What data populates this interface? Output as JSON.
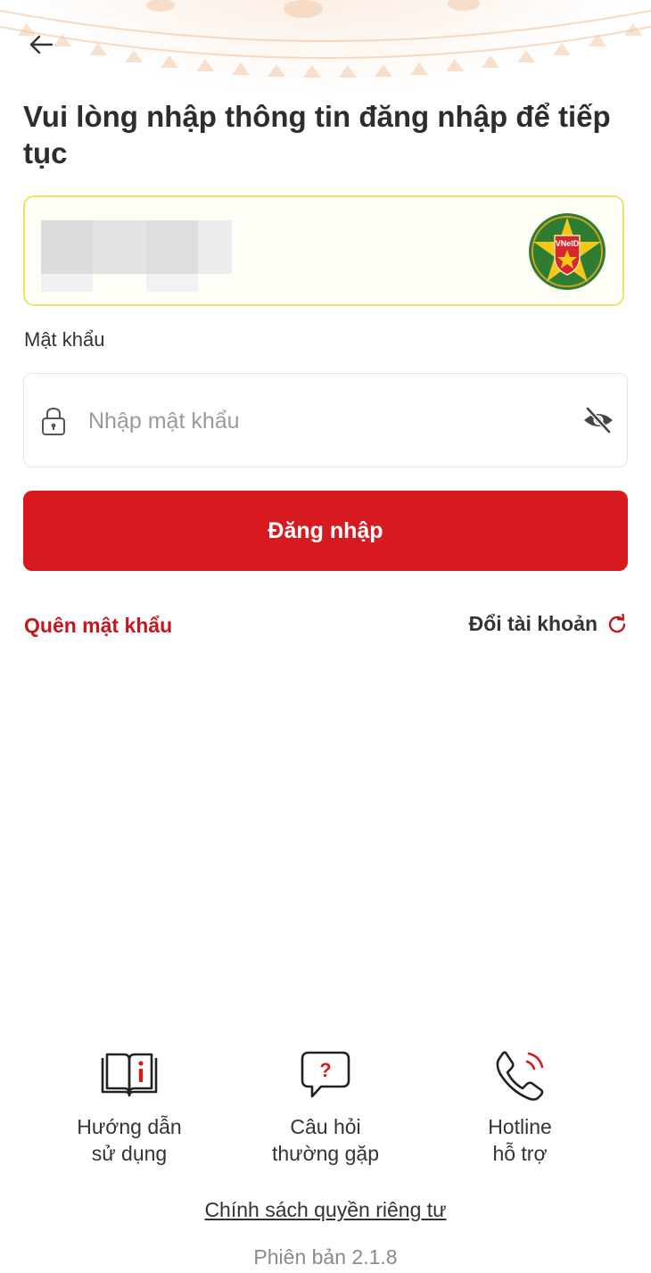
{
  "header": {
    "back_icon": "arrow-left-icon"
  },
  "headline": "Vui lòng nhập thông tin đăng nhập để tiếp tục",
  "account": {
    "logo_text": "VNeID",
    "logo_icon": "vneid-emblem-icon",
    "highlight_color": "#efe06a"
  },
  "password": {
    "label": "Mật khẩu",
    "placeholder": "Nhập mật khẩu",
    "value": "",
    "left_icon": "lock-icon",
    "right_icon": "eye-off-icon"
  },
  "login_button": {
    "label": "Đăng nhập",
    "color": "#d71920"
  },
  "links": {
    "forgot_password": "Quên mật khẩu",
    "switch_account": "Đổi tài khoản",
    "switch_account_icon": "refresh-icon"
  },
  "help": [
    {
      "line1": "Hướng dẫn",
      "line2": "sử dụng",
      "icon": "book-info-icon"
    },
    {
      "line1": "Câu hỏi",
      "line2": "thường gặp",
      "icon": "question-chat-icon"
    },
    {
      "line1": "Hotline",
      "line2": "hỗ trợ",
      "icon": "phone-call-icon"
    }
  ],
  "footer": {
    "privacy": "Chính sách quyền riêng tư",
    "version": "Phiên bản 2.1.8"
  }
}
